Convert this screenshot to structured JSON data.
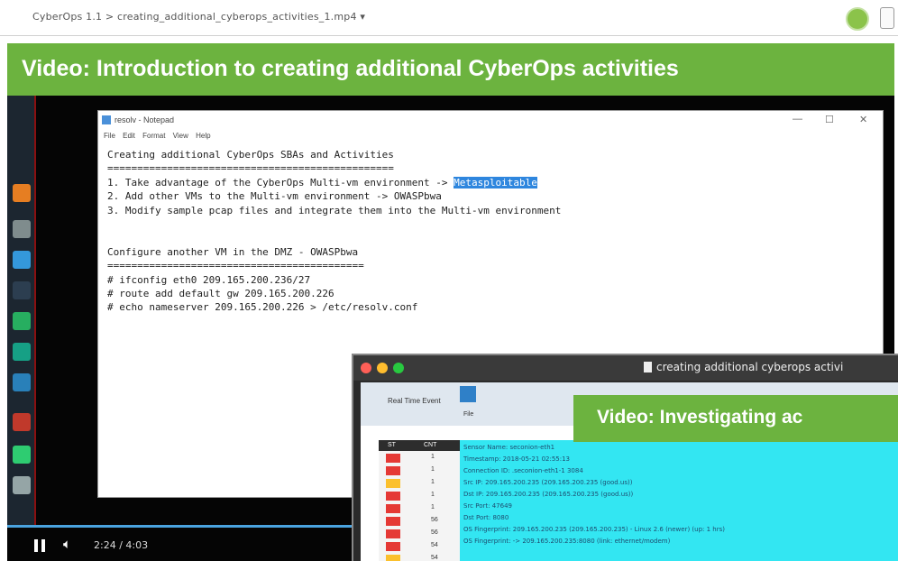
{
  "topbar": {
    "breadcrumb": "CyberOps 1.1  >  creating_additional_cyberops_activities_1.mp4 ▾"
  },
  "banner": {
    "title": "Video: Introduction to creating additional CyberOps activities"
  },
  "notepad": {
    "title": "resolv - Notepad",
    "menu": "File  Edit  Format  View  Help",
    "window_controls": [
      "—",
      "☐",
      "✕"
    ],
    "lines": [
      "Creating additional CyberOps SBAs and Activities",
      "================================================",
      "1. Take advantage of the CyberOps Multi-vm environment -> ",
      "2. Add other VMs to the Multi-vm environment -> OWASPbwa",
      "3. Modify sample pcap files and integrate them into the Multi-vm environment",
      "",
      "",
      "Configure another VM in the DMZ - OWASPbwa",
      "===========================================",
      "# ifconfig eth0 209.165.200.236/27",
      "# route add default gw 209.165.200.226",
      "# echo nameserver 209.165.200.226 > /etc/resolv.conf"
    ],
    "highlight": "Metasploitable"
  },
  "player": {
    "time": "2:24 / 4:03",
    "progress": 0.59,
    "icons": [
      "pause-icon",
      "volume-icon"
    ]
  },
  "thumbnail": {
    "window_title": "creating additional cyberops activi",
    "toolbar_label": "Real Time Event",
    "file_label": "File",
    "banner": "Video: Investigating ac",
    "table_headers": [
      "ST",
      "CNT"
    ],
    "rows": [
      {
        "count": "1",
        "color": "#e53935"
      },
      {
        "count": "1",
        "color": "#e53935"
      },
      {
        "count": "1",
        "color": "#fbc02d"
      },
      {
        "count": "1",
        "color": "#e53935"
      },
      {
        "count": "1",
        "color": "#e53935"
      },
      {
        "count": "56",
        "color": "#e53935"
      },
      {
        "count": "56",
        "color": "#e53935"
      },
      {
        "count": "54",
        "color": "#e53935"
      },
      {
        "count": "54",
        "color": "#fbc02d"
      }
    ],
    "details": [
      "Sensor Name: seconion-eth1",
      "Timestamp: 2018-05-21 02:55:13",
      "Connection ID: .seconion-eth1-1 3084",
      "Src IP:             209.165.200.235 (209.165.200.235 (good.us))",
      "Dst IP:             209.165.200.235 (209.165.200.235 (good.us))",
      "Src Port:           47649",
      "Dst Port:           8080",
      "OS Fingerprint: 209.165.200.235 (209.165.200.235) - Linux 2.6 (newer) (up: 1 hrs)",
      "OS Fingerprint: -> 209.165.200.235:8080 (link: ethernet/modem)"
    ]
  },
  "colors": {
    "banner_green": "#6cb33f",
    "highlight_blue": "#2e86de",
    "detail_cyan": "#33e6f2"
  }
}
